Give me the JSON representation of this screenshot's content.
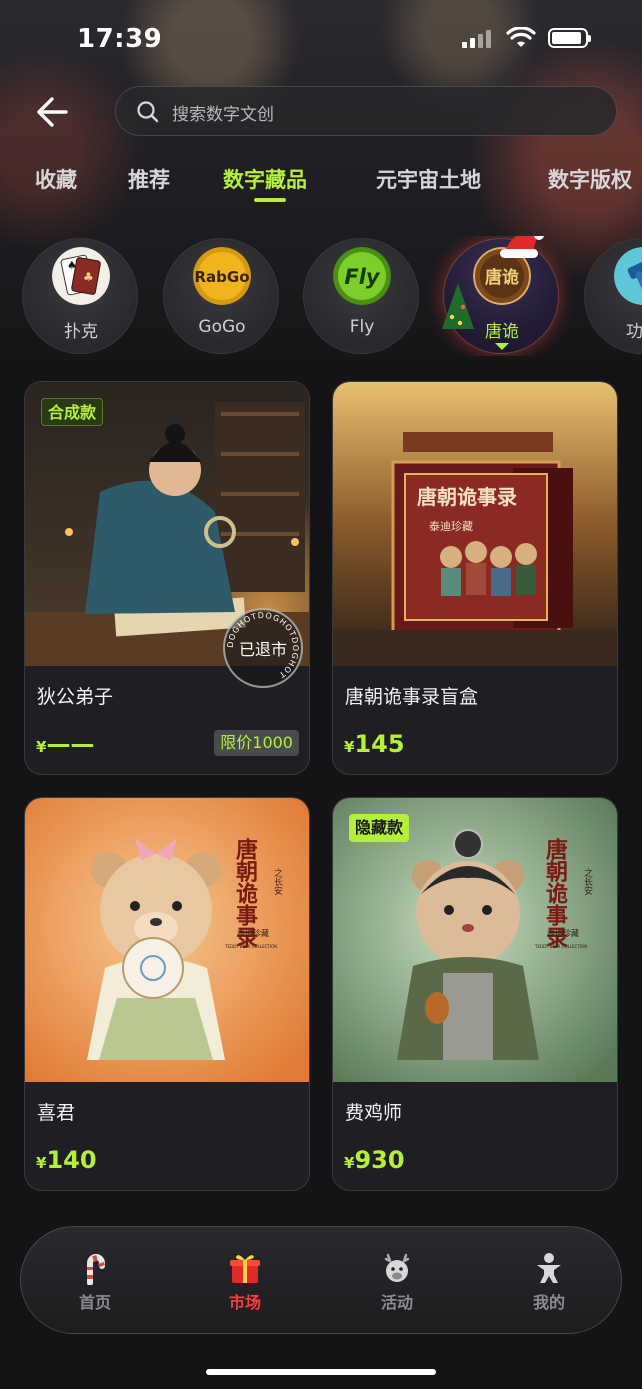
{
  "status_bar": {
    "time": "17:39"
  },
  "search": {
    "placeholder": "搜索数字文创"
  },
  "tabs": [
    {
      "label": "收藏"
    },
    {
      "label": "推荐"
    },
    {
      "label": "数字藏品",
      "active": true
    },
    {
      "label": "元宇宙土地"
    },
    {
      "label": "数字版权"
    }
  ],
  "categories": [
    {
      "label": "扑克",
      "logo_text": "",
      "icon": "poker-card-icon"
    },
    {
      "label": "GoGo",
      "logo_text": "RabGo",
      "icon": "gogo-logo"
    },
    {
      "label": "Fly",
      "logo_text": "Fly",
      "icon": "fly-logo"
    },
    {
      "label": "唐诡",
      "logo_text": "唐诡",
      "icon": "tanggui-logo",
      "active": true
    },
    {
      "label": "功能",
      "logo_text": "",
      "icon": "hammer-icon"
    }
  ],
  "products": [
    {
      "name": "狄公弟子",
      "currency": "¥",
      "price": "——",
      "badge": "合成款",
      "limit": "限价1000",
      "stamp": "已退市",
      "stamp_ring": "DOGHOTDOGHOTDOGHOT"
    },
    {
      "name": "唐朝诡事录盲盒",
      "currency": "¥",
      "price": "145",
      "box_title": "唐朝诡事录",
      "box_sub": "泰迪珍藏"
    },
    {
      "name": "喜君",
      "currency": "¥",
      "price": "140",
      "poster_title": "唐朝诡事录",
      "poster_sub": "之长安",
      "poster_brand": "泰迪珍藏",
      "poster_en": "TEDDY BEAR COLLECTION"
    },
    {
      "name": "费鸡师",
      "currency": "¥",
      "price": "930",
      "badge": "隐藏款",
      "poster_title": "唐朝诡事录",
      "poster_sub": "之长安",
      "poster_brand": "泰迪珍藏",
      "poster_en": "TEDDY BEAR COLLECTION"
    }
  ],
  "nav": [
    {
      "label": "首页",
      "icon": "candy-cane-icon"
    },
    {
      "label": "市场",
      "icon": "gift-icon",
      "active": true
    },
    {
      "label": "活动",
      "icon": "reindeer-icon"
    },
    {
      "label": "我的",
      "icon": "person-icon"
    }
  ],
  "colors": {
    "accent": "#b4f03a",
    "nav_active": "#ff3b3b",
    "background": "#141416",
    "card": "#1f1f23"
  }
}
